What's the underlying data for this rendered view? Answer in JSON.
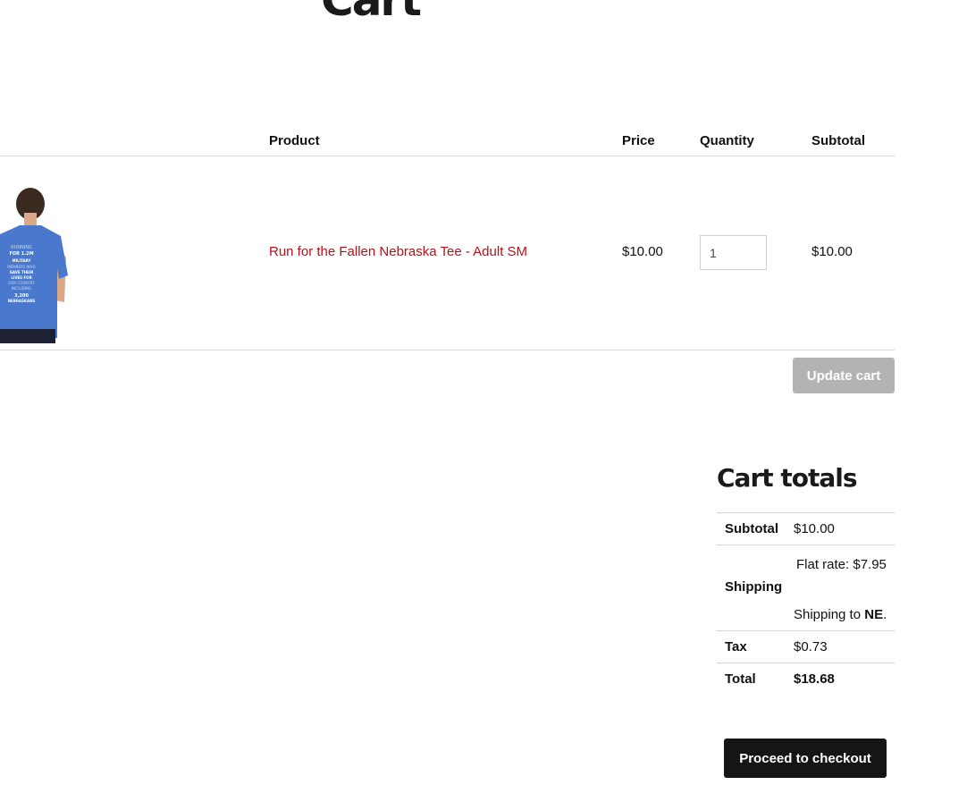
{
  "page": {
    "title": "Cart"
  },
  "cart_table": {
    "headers": {
      "product": "Product",
      "price": "Price",
      "quantity": "Quantity",
      "subtotal": "Subtotal"
    },
    "items": [
      {
        "name": "Run for the Fallen Nebraska Tee - Adult SM",
        "price": "$10.00",
        "quantity": "1",
        "subtotal": "$10.00",
        "image": "blue-tshirt-back-photo",
        "shirt_text": [
          "RUNNING",
          "FOR 1.2M",
          "MILITARY",
          "MEMBERS WHO",
          "GAVE THEIR",
          "LIVES FOR",
          "OUR COUNTRY",
          "INCLUDING",
          "3,200",
          "NEBRASKANS"
        ]
      }
    ],
    "update_button_label": "Update cart"
  },
  "cart_totals": {
    "title": "Cart totals",
    "subtotal_label": "Subtotal",
    "subtotal_value": "$10.00",
    "shipping_label": "Shipping",
    "shipping_rate": "Flat rate: $7.95",
    "shipping_to_prefix": "Shipping to ",
    "shipping_to_state": "NE",
    "shipping_to_suffix": ".",
    "tax_label": "Tax",
    "tax_value": "$0.73",
    "total_label": "Total",
    "total_value": "$18.68",
    "checkout_button_label": "Proceed to checkout"
  },
  "colors": {
    "link": "#b5121b",
    "update_button_bg": "#b3b3b3",
    "checkout_button_bg": "#151515",
    "shirt_blue": "#4a78cc"
  }
}
